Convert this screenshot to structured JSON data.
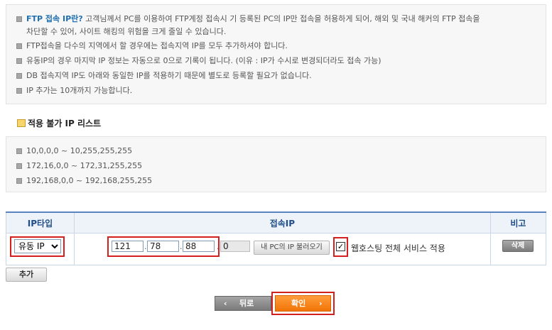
{
  "notice": {
    "line1_head": "FTP 접속 IP란?",
    "line1_body": " 고객님께서 PC를 이용하여 FTP계정 접속시 기 등록된 PC의 IP만 접속을 허용하게 되어, 해외 및 국내 해커의 FTP 접속을",
    "line1_cont": "차단할 수 있어, 사이트 해킹의 위험을 크게 줄일 수 있습니다.",
    "line2": "FTP접속을 다수의 지역에서 할 경우에는 접속지역 IP를 모두 추가하셔야 합니다.",
    "line3": "유동IP의 경우 마지막 IP 정보는 자동으로 0으로 기록이 됩니다. (이유 : IP가 수시로 변경되더라도 접속 가능)",
    "line4": "DB 접속지역 IP도 아래와 동일한 IP를 적용하기 때문에 별도로 등록할 필요가 없습니다.",
    "line5": "IP 추가는 10개까지 가능합니다."
  },
  "blocked": {
    "title": "적용 불가 IP 리스트",
    "items": [
      "10,0,0,0 ~ 10,255,255,255",
      "172,16,0,0 ~ 172,31,255,255",
      "192,168,0,0 ~ 192,168,255,255"
    ]
  },
  "table": {
    "headers": [
      "IP타입",
      "접속IP",
      "비고"
    ],
    "iptype_options": [
      "유동 IP"
    ],
    "ip1": "121",
    "ip2": "78",
    "ip3": "88",
    "ip4": "0",
    "load_pc_ip": "내 PC의 IP 불러오기",
    "webhosting_label": "웹호스팅 전체 서비스 적용",
    "checkmark": "✓",
    "delete": "삭제"
  },
  "add_button": "추가",
  "back_button": "뒤로",
  "back_arrow": "‹",
  "ok_button": "확인",
  "ok_arrow": "›"
}
